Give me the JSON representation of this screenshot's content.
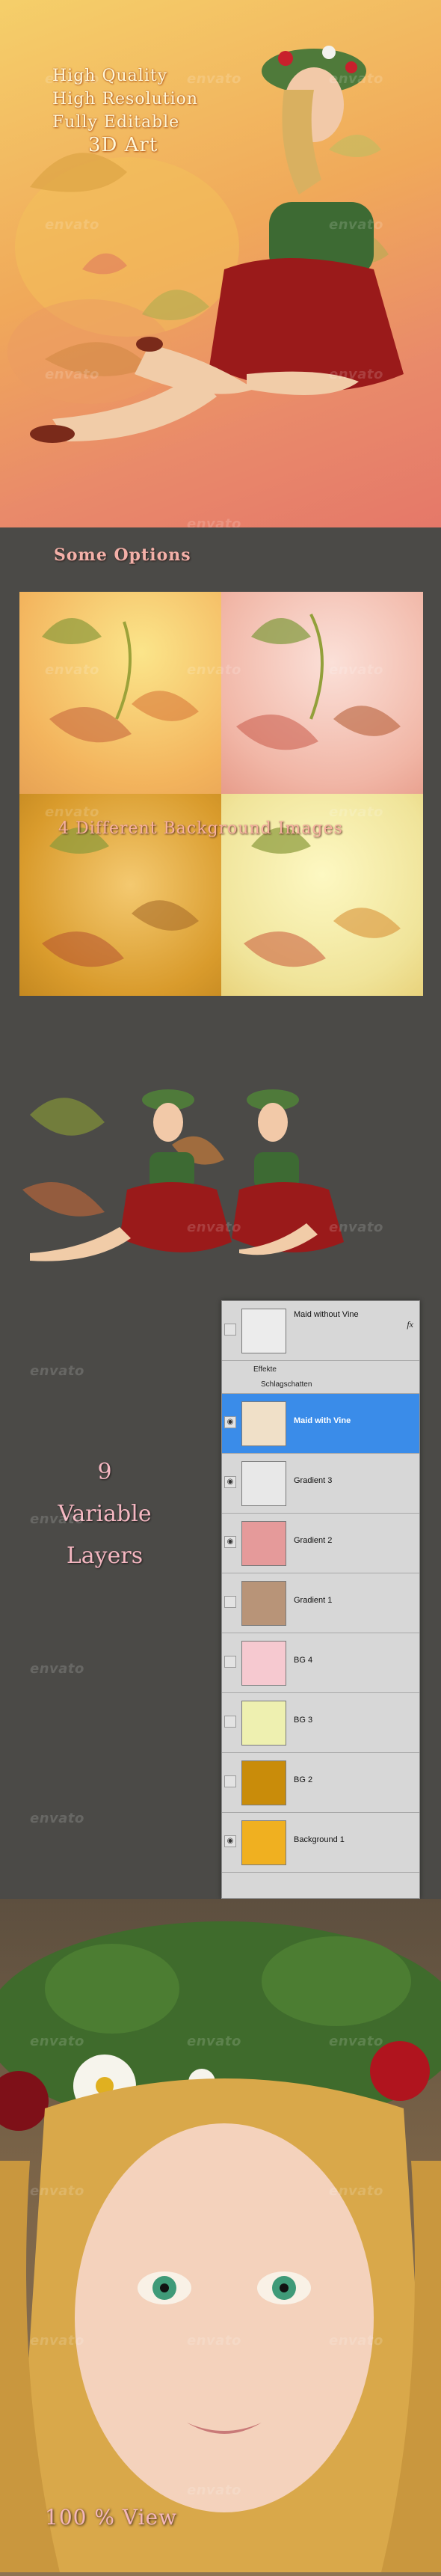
{
  "hero": {
    "lines": [
      "High Quality",
      "High Resolution",
      "Fully Editable",
      "3D Art"
    ]
  },
  "watermark": {
    "text": "envato"
  },
  "options": {
    "title": "Some Options",
    "band": "4 Different Background Images",
    "tiles": [
      {
        "name": "golden-yellow",
        "color": "#f3b45d"
      },
      {
        "name": "soft-pink",
        "color": "#f1b6a6"
      },
      {
        "name": "amber",
        "color": "#d99b2c"
      },
      {
        "name": "pale-yellow",
        "color": "#f0e49a"
      }
    ]
  },
  "layers": {
    "count_number": "9",
    "count_words": [
      "Variable",
      "Layers"
    ],
    "panel": {
      "top_layer": "Maid without Vine",
      "fx": "fx",
      "effects_label": "Effekte",
      "effect_item": "Schlagschatten",
      "rows": [
        {
          "label": "Maid with Vine",
          "selected": true,
          "thumb": "#f0e0c8"
        },
        {
          "label": "Gradient 3",
          "selected": false,
          "thumb": "#e8e8e8"
        },
        {
          "label": "Gradient 2",
          "selected": false,
          "thumb": "#e59a9a"
        },
        {
          "label": "Gradient 1",
          "selected": false,
          "thumb": "#b89478"
        },
        {
          "label": "BG 4",
          "selected": false,
          "thumb": "#f6c9d0"
        },
        {
          "label": "BG 3",
          "selected": false,
          "thumb": "#eef0b0"
        },
        {
          "label": "BG 2",
          "selected": false,
          "thumb": "#c98c0a"
        },
        {
          "label": "Background 1",
          "selected": false,
          "thumb": "#f0b020"
        }
      ]
    }
  },
  "portrait": {
    "label": "100 % View"
  }
}
